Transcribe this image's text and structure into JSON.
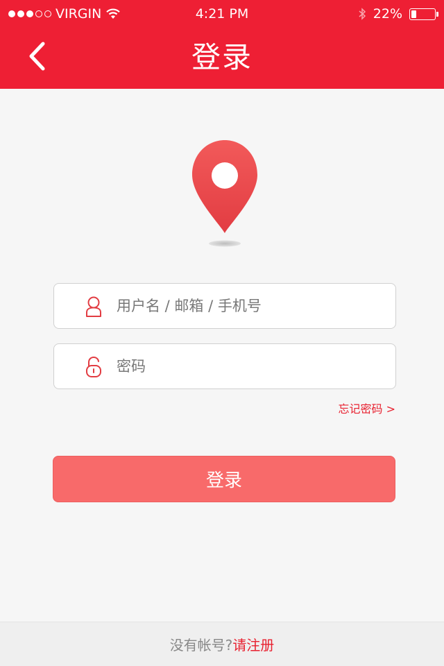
{
  "status_bar": {
    "carrier": "VIRGIN",
    "time": "4:21 PM",
    "battery": "22%",
    "battery_level": 0.22
  },
  "header": {
    "title": "登录",
    "back_icon": "chevron-left-icon"
  },
  "logo": {
    "icon": "location-pin-icon"
  },
  "form": {
    "username_placeholder": "用户名 / 邮箱 / 手机号",
    "password_placeholder": "密码",
    "forgot_password": "忘记密码 >",
    "login_button": "登录"
  },
  "footer": {
    "prompt": "没有帐号?",
    "register": "请注册"
  },
  "colors": {
    "brand_red": "#ee1f34",
    "button_red": "#f86a6a",
    "link_red": "#e8202f",
    "background": "#f6f6f6"
  }
}
